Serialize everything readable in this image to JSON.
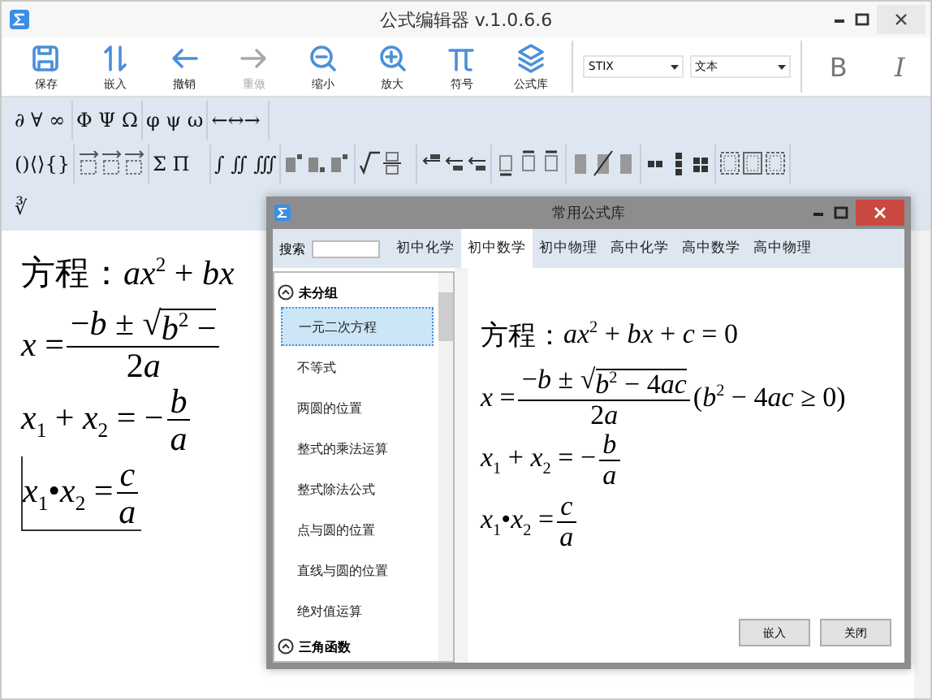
{
  "window": {
    "title": "公式编辑器 v.1.0.6.6"
  },
  "toolbar": {
    "buttons": [
      {
        "kind": "save",
        "label": "保存",
        "disabled": false
      },
      {
        "kind": "embed",
        "label": "嵌入",
        "disabled": false
      },
      {
        "kind": "undo",
        "label": "撤销",
        "disabled": false
      },
      {
        "kind": "redo",
        "label": "重做",
        "disabled": true
      },
      {
        "kind": "zoom-out",
        "label": "缩小",
        "disabled": false
      },
      {
        "kind": "zoom-in",
        "label": "放大",
        "disabled": false
      },
      {
        "kind": "symbol",
        "label": "符号",
        "disabled": false
      },
      {
        "kind": "library",
        "label": "公式库",
        "disabled": false
      }
    ],
    "font_select": {
      "value": "STIX"
    },
    "style_select": {
      "value": "文本"
    },
    "bold": "B",
    "italic": "I"
  },
  "symbol_rows": [
    [
      {
        "kind": "text",
        "text": "∂ ∀ ∞"
      },
      {
        "kind": "text",
        "text": "Φ Ψ Ω"
      },
      {
        "kind": "text",
        "text": "φ ψ ω"
      },
      {
        "kind": "text",
        "text": "←↔→"
      }
    ],
    [
      {
        "kind": "text",
        "text": "()⟨⟩{}"
      },
      {
        "kind": "template"
      },
      {
        "kind": "text",
        "text": "Σ Π"
      },
      {
        "kind": "text",
        "text": "∫ ∬ ∭"
      },
      {
        "kind": "template"
      },
      {
        "kind": "template"
      },
      {
        "kind": "template"
      },
      {
        "kind": "template"
      },
      {
        "kind": "template"
      },
      {
        "kind": "template"
      },
      {
        "kind": "template"
      }
    ],
    [
      {
        "kind": "text",
        "text": "∛"
      }
    ]
  ],
  "editor": {
    "formulas": [
      {
        "active": false,
        "parts": [
          {
            "kind": "cn",
            "text": "方程："
          },
          {
            "kind": "math",
            "text": "*ax*$^{2}$ + *bx*"
          }
        ]
      },
      {
        "active": false,
        "parts": [
          {
            "kind": "math",
            "text": "*x* = "
          },
          {
            "kind": "frac",
            "num": [
              {
                "kind": "math",
                "text": "−*b* ± "
              },
              {
                "kind": "sqrt",
                "sign": "√",
                "body": [
                  {
                    "kind": "math",
                    "text": "*b*$^{2}$ −"
                  }
                ]
              }
            ],
            "den": [
              {
                "kind": "math",
                "text": "2"
              },
              {
                "kind": "math",
                "text": "*a*"
              }
            ]
          }
        ]
      },
      {
        "active": false,
        "parts": [
          {
            "kind": "math",
            "text": "*x*$_{1}$ + *x*$_{2}$ = −"
          },
          {
            "kind": "frac",
            "num": [
              {
                "kind": "math",
                "text": "*b*"
              }
            ],
            "den": [
              {
                "kind": "math",
                "text": "*a*"
              }
            ]
          }
        ]
      },
      {
        "active": true,
        "parts": [
          {
            "kind": "math",
            "text": "*x*$_{1}$•*x*$_{2}$ = "
          },
          {
            "kind": "frac",
            "num": [
              {
                "kind": "math",
                "text": "*c*"
              }
            ],
            "den": [
              {
                "kind": "math",
                "text": "*a*"
              }
            ]
          }
        ]
      }
    ]
  },
  "dialog": {
    "title": "常用公式库",
    "search": {
      "label": "搜索"
    },
    "tabs": [
      {
        "label": "初中化学",
        "selected": false
      },
      {
        "label": "初中数学",
        "selected": true
      },
      {
        "label": "初中物理",
        "selected": false
      },
      {
        "label": "高中化学",
        "selected": false
      },
      {
        "label": "高中数学",
        "selected": false
      },
      {
        "label": "高中物理",
        "selected": false
      }
    ],
    "groups": [
      {
        "label": "未分组",
        "expanded": true,
        "items": [
          {
            "label": "一元二次方程",
            "selected": true
          },
          {
            "label": "不等式",
            "selected": false
          },
          {
            "label": "两圆的位置",
            "selected": false
          },
          {
            "label": "整式的乘法运算",
            "selected": false
          },
          {
            "label": "整式除法公式",
            "selected": false
          },
          {
            "label": "点与圆的位置",
            "selected": false
          },
          {
            "label": "直线与圆的位置",
            "selected": false
          },
          {
            "label": "绝对值运算",
            "selected": false
          }
        ]
      },
      {
        "label": "三角函数",
        "expanded": true
      }
    ],
    "formulas": [
      {
        "parts": [
          {
            "kind": "cn",
            "text": "方程："
          },
          {
            "kind": "math",
            "text": "*ax*$^{2}$ + *bx* + *c* = 0"
          }
        ]
      },
      {
        "parts": [
          {
            "kind": "math",
            "text": "*x* = "
          },
          {
            "kind": "frac",
            "num": [
              {
                "kind": "math",
                "text": "−*b* ± "
              },
              {
                "kind": "sqrt",
                "sign": "√",
                "body": [
                  {
                    "kind": "math",
                    "text": "*b*$^{2}$ − 4"
                  },
                  {
                    "kind": "math",
                    "text": "*ac*"
                  }
                ]
              }
            ],
            "den": [
              {
                "kind": "math",
                "text": "2"
              },
              {
                "kind": "math",
                "text": "*a*"
              }
            ]
          },
          {
            "kind": "math",
            "text": " (*b*$^{2}$ − 4"
          },
          {
            "kind": "math",
            "text": "*ac* ≥ 0)"
          }
        ]
      },
      {
        "parts": [
          {
            "kind": "math",
            "text": "*x*$_{1}$ + *x*$_{2}$ = −"
          },
          {
            "kind": "frac",
            "num": [
              {
                "kind": "math",
                "text": "*b*"
              }
            ],
            "den": [
              {
                "kind": "math",
                "text": "*a*"
              }
            ]
          }
        ]
      },
      {
        "parts": [
          {
            "kind": "math",
            "text": "*x*$_{1}$•*x*$_{2}$ = "
          },
          {
            "kind": "frac",
            "num": [
              {
                "kind": "math",
                "text": "*c*"
              }
            ],
            "den": [
              {
                "kind": "math",
                "text": "*a*"
              }
            ]
          }
        ]
      }
    ],
    "buttons": [
      "嵌入",
      "关闭"
    ]
  }
}
